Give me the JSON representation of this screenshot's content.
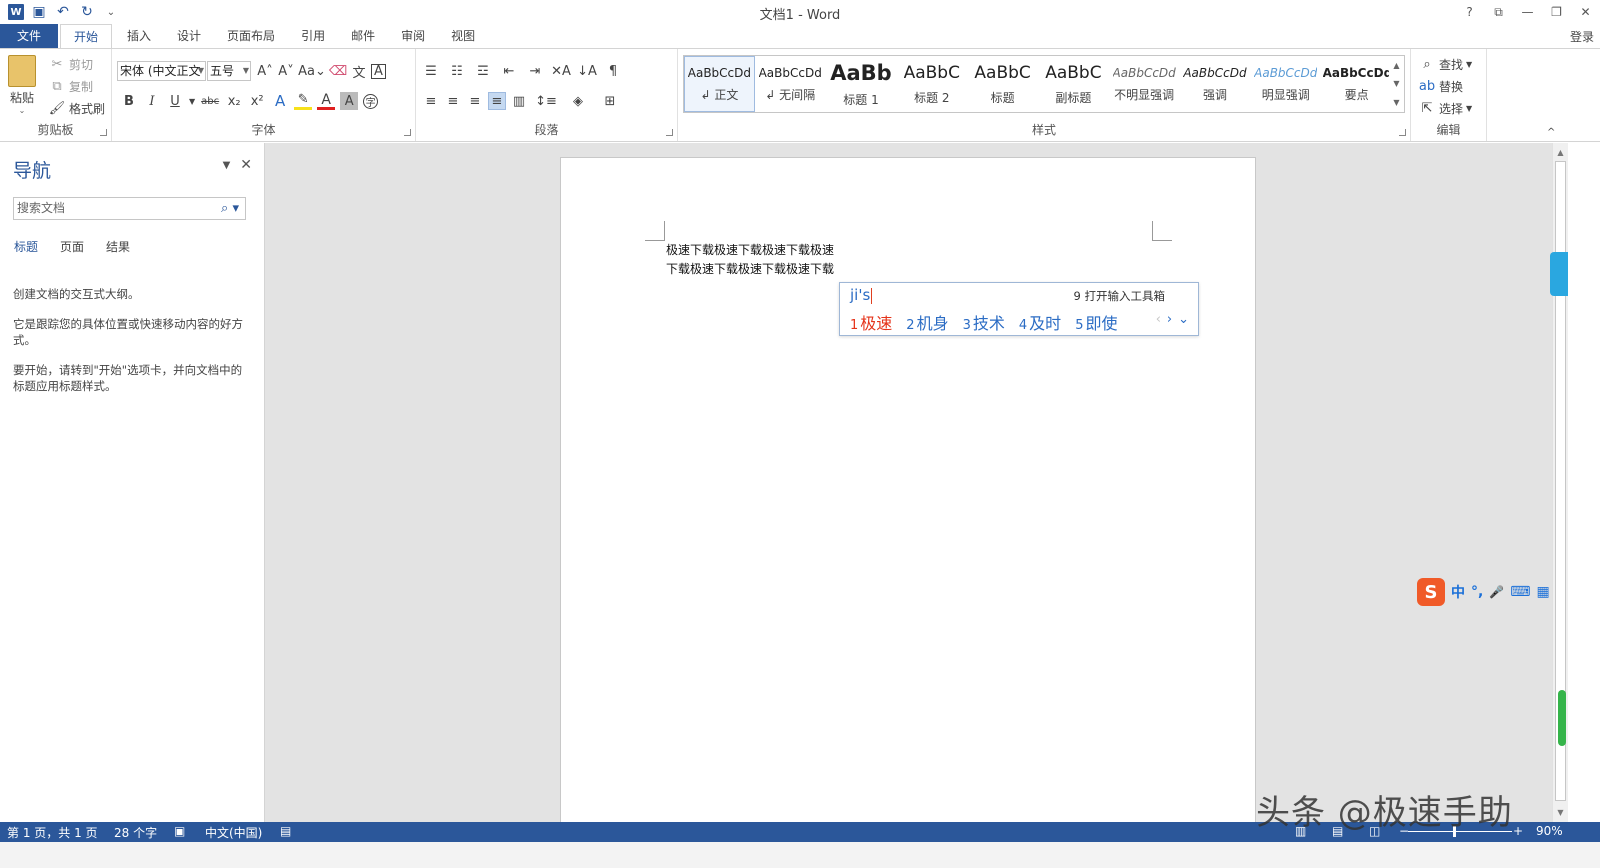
{
  "window": {
    "title": "文档1 - Word",
    "controls": [
      "?",
      "⧉",
      "—",
      "❐",
      "✕"
    ]
  },
  "qat": {
    "undo_label": "↶",
    "redo_label": "↻",
    "customize_label": "⌄"
  },
  "tabs": [
    {
      "label": "文件"
    },
    {
      "label": "开始"
    },
    {
      "label": "插入"
    },
    {
      "label": "设计"
    },
    {
      "label": "页面布局"
    },
    {
      "label": "引用"
    },
    {
      "label": "邮件"
    },
    {
      "label": "审阅"
    },
    {
      "label": "视图"
    }
  ],
  "login_label": "登录",
  "clipboard": {
    "paste": "粘贴",
    "cut": "剪切",
    "copy": "复制",
    "format_painter": "格式刷",
    "group": "剪贴板"
  },
  "font": {
    "name": "宋体 (中文正文",
    "size": "五号",
    "group": "字体",
    "bold": "B",
    "italic": "I",
    "underline": "U",
    "strike": "abc",
    "sub": "x₂",
    "sup": "x²"
  },
  "paragraph": {
    "group": "段落"
  },
  "styles": {
    "group": "样式",
    "items": [
      {
        "preview": "AaBbCcDd",
        "name": "↲ 正文"
      },
      {
        "preview": "AaBbCcDd",
        "name": "↲ 无间隔"
      },
      {
        "preview": "AaBb",
        "name": "标题 1"
      },
      {
        "preview": "AaBbC",
        "name": "标题 2"
      },
      {
        "preview": "AaBbC",
        "name": "标题"
      },
      {
        "preview": "AaBbC",
        "name": "副标题"
      },
      {
        "preview": "AaBbCcDd",
        "name": "不明显强调"
      },
      {
        "preview": "AaBbCcDd",
        "name": "强调"
      },
      {
        "preview": "AaBbCcDd",
        "name": "明显强调"
      },
      {
        "preview": "AaBbCcDd",
        "name": "要点"
      }
    ]
  },
  "editing": {
    "find": "查找",
    "replace": "替换",
    "select": "选择",
    "group": "编辑"
  },
  "nav": {
    "title": "导航",
    "search_placeholder": "搜索文档",
    "tabs": [
      "标题",
      "页面",
      "结果"
    ],
    "text": [
      "创建文档的交互式大纲。",
      "它是跟踪您的具体位置或快速移动内容的好方式。",
      "要开始，请转到\"开始\"选项卡，并向文档中的标题应用标题样式。"
    ]
  },
  "document": {
    "line1": "极速下载极速下载极速下载极速",
    "line2": "下载极速下载极速下载极速下载"
  },
  "ime": {
    "input": "ji's",
    "tool": "9 打开输入工具箱",
    "candidates": [
      {
        "n": "1",
        "text": "极速"
      },
      {
        "n": "2",
        "text": "机身"
      },
      {
        "n": "3",
        "text": "技术"
      },
      {
        "n": "4",
        "text": "及时"
      },
      {
        "n": "5",
        "text": "即使"
      }
    ]
  },
  "sogou": {
    "logo": "S",
    "mode": "中",
    "punct": "°,",
    "mic": "🎤",
    "keyboard": "⌨",
    "menu": "▦"
  },
  "status": {
    "page": "第 1 页，共 1 页",
    "words": "28 个字",
    "language": "中文(中国)",
    "zoom": "90%"
  },
  "watermark": "头条 @极速手助"
}
